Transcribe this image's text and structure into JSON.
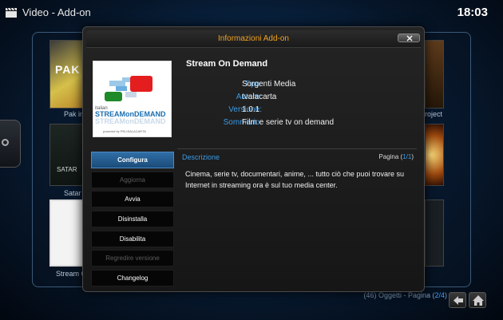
{
  "app": {
    "title": "Video  - Add-on",
    "clock": "18:03"
  },
  "background": {
    "tiles": [
      {
        "label": "Pak in",
        "text": "PAK"
      },
      {
        "label": "Satar",
        "text": "SATAR"
      },
      {
        "label": "Stream O"
      },
      {
        "label": "roject"
      }
    ],
    "pager": {
      "prefix": "(46) Oggetti - Pagina (",
      "page": "2/4",
      "suffix": ")"
    }
  },
  "dialog": {
    "title": "Informazioni Add-on",
    "thumbnail": {
      "line1": "italian",
      "line2": "STREAMonDEMAND",
      "line3": "STREAMonDEMAND",
      "line4": "powered by PELISALACARTA"
    },
    "addon_name": "Stream On Demand",
    "info": [
      {
        "label": "Tipo:",
        "value": "Sorgenti Media"
      },
      {
        "label": "Autore:",
        "value": "tvalacarta"
      },
      {
        "label": "Versione:",
        "value": "1.0.1"
      },
      {
        "label": "Sommario:",
        "value": "Film e serie tv on demand"
      }
    ],
    "menu": [
      {
        "label": "Configura",
        "state": "selected"
      },
      {
        "label": "Aggiorna",
        "state": "disabled"
      },
      {
        "label": "Avvia",
        "state": "normal"
      },
      {
        "label": "Disinstalla",
        "state": "normal"
      },
      {
        "label": "Disabilita",
        "state": "normal"
      },
      {
        "label": "Regredire versione",
        "state": "disabled"
      },
      {
        "label": "Changelog",
        "state": "normal"
      }
    ],
    "description_label": "Descrizione",
    "page": {
      "prefix": "Pagina (",
      "number": "1/1",
      "suffix": ")"
    },
    "description": "Cinema, serie tv, documentari, anime, ... tutto ciò che puoi trovare su Internet in streaming ora è sul tuo media center."
  },
  "colors": {
    "accent_blue": "#3a9be6",
    "title_orange": "#f2a320",
    "selected_button": "#2f6ea6"
  },
  "icons": [
    "clapperboard-icon",
    "close-icon",
    "back-arrow-icon",
    "home-icon"
  ]
}
